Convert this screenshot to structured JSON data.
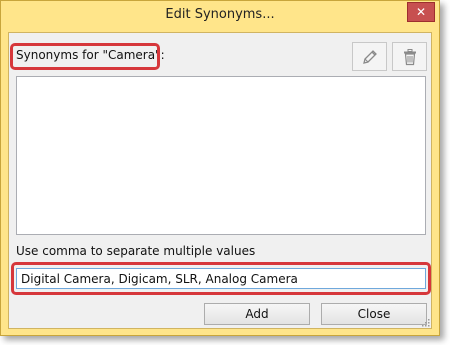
{
  "window": {
    "title": "Edit Synonyms...",
    "close_glyph": "✕"
  },
  "synonyms": {
    "label": "Synonyms for \"Camera\":",
    "items": [],
    "edit_icon": "pencil-icon",
    "delete_icon": "trash-icon"
  },
  "entry": {
    "hint": "Use comma to separate multiple values",
    "value": "Digital Camera, Digicam, SLR, Analog Camera"
  },
  "buttons": {
    "add": "Add",
    "close": "Close"
  },
  "colors": {
    "frame": "#ffe58a",
    "highlight": "#d6373b",
    "close_button": "#c75050"
  }
}
